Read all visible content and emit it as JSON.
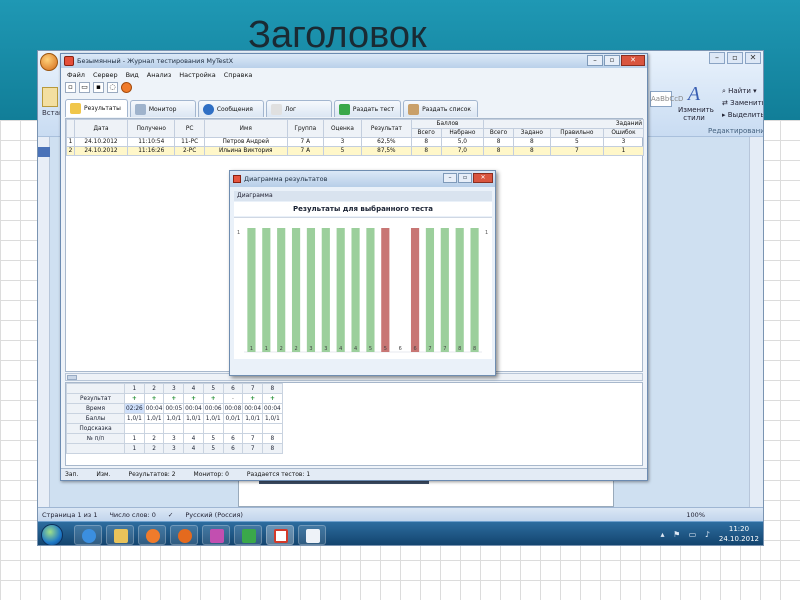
{
  "slide": {
    "title": "Заголовок"
  },
  "colors": {
    "band": "#1d93b0",
    "correct": "#9ccf9c",
    "wrong": "#c87674"
  },
  "word": {
    "left_label": "Вставит",
    "change_styles": "Изменить стили",
    "find": "Найти",
    "replace": "Заменить",
    "select": "Выделить",
    "edit_group": "Редактирование",
    "style_pill": "AaBbCcD"
  },
  "window": {
    "title": "Безымянный - Журнал тестирования MyTestX",
    "menu": [
      "Файл",
      "Сервер",
      "Вид",
      "Анализ",
      "Настройка",
      "Справка"
    ],
    "tabs": [
      "Результаты",
      "Монитор",
      "Сообщения",
      "Лог",
      "Раздать тест",
      "Раздать список"
    ]
  },
  "results": {
    "headers": [
      "Дата",
      "Получено",
      "PC",
      "Имя",
      "Группа",
      "Оценка",
      "Результат"
    ],
    "balls_header": "Баллов",
    "tasks_header": "Заданий",
    "sub": [
      "Всего",
      "Набрано",
      "Всего",
      "Задано",
      "Правильно",
      "Ошибок"
    ],
    "rows": [
      {
        "n": "1",
        "date": "24.10.2012",
        "got": "11:10:54",
        "pc": "11-PC",
        "name": "Петров Андрей",
        "group": "7 А",
        "mark": "3",
        "result": "62,5%",
        "b_total": "8",
        "b_got": "5,0",
        "t_total": "8",
        "t_given": "8",
        "t_right": "5",
        "t_err": "3"
      },
      {
        "n": "2",
        "date": "24.10.2012",
        "got": "11:16:26",
        "pc": "2-PC",
        "name": "Ильина Виктория",
        "group": "7 А",
        "mark": "5",
        "result": "87,5%",
        "b_total": "8",
        "b_got": "7,0",
        "t_total": "8",
        "t_given": "8",
        "t_right": "7",
        "t_err": "1"
      }
    ]
  },
  "detail": {
    "cols": [
      "1",
      "2",
      "3",
      "4",
      "5",
      "6",
      "7",
      "8"
    ],
    "result_label": "Результат",
    "result_marks": [
      "+",
      "+",
      "+",
      "+",
      "+",
      "-",
      "+",
      "+"
    ],
    "time_label": "Время",
    "times": [
      "02:26",
      "00:04",
      "00:05",
      "00:04",
      "00:06",
      "00:08",
      "00:04",
      "00:04"
    ],
    "balls_label": "Баллы",
    "balls": [
      "1,0/1",
      "1,0/1",
      "1,0/1",
      "1,0/1",
      "1,0/1",
      "0,0/1",
      "1,0/1",
      "1,0/1"
    ],
    "hint_label": "Подсказка",
    "num_label": "№ п/п",
    "nums": [
      "1",
      "2",
      "3",
      "4",
      "5",
      "6",
      "7",
      "8"
    ],
    "footer": [
      "1",
      "2",
      "3",
      "4",
      "5",
      "6",
      "7",
      "8"
    ]
  },
  "status": {
    "zap": "Зап.",
    "izm": "Изм.",
    "results": "Результатов: 2",
    "monitor": "Монитор: 0",
    "given": "Раздается тестов: 1"
  },
  "dialog": {
    "title": "Диаграмма результатов",
    "subtitle": "Диаграмма",
    "heading": "Результаты для выбранного теста"
  },
  "chart_data": {
    "type": "bar",
    "title": "Результаты для выбранного теста",
    "ylim": [
      0,
      1
    ],
    "y_ticks": [
      "1",
      "1"
    ],
    "categories": [
      "1",
      "2",
      "3",
      "4",
      "5",
      "6",
      "7",
      "8"
    ],
    "series": [
      {
        "values": [
          1,
          1,
          1,
          1,
          1,
          0,
          1,
          1
        ],
        "labels": [
          "1",
          "2",
          "3",
          "4",
          "5",
          "6",
          "7",
          "8"
        ],
        "status": [
          "correct",
          "correct",
          "correct",
          "correct",
          "correct",
          "wrong",
          "correct",
          "correct"
        ]
      },
      {
        "values": [
          1,
          1,
          1,
          1,
          1,
          1,
          1,
          1
        ],
        "labels": [
          "1",
          "2",
          "3",
          "4",
          "5",
          "6",
          "7",
          "8"
        ],
        "status": [
          "correct",
          "correct",
          "correct",
          "correct",
          "wrong",
          "wrong",
          "correct",
          "correct"
        ]
      }
    ]
  },
  "word_status": {
    "page": "Страница 1 из 1",
    "words": "Число слов: 0",
    "lang": "Русский (Россия)",
    "zoom": "100%"
  },
  "taskbar": {
    "time": "11:20",
    "date": "24.10.2012"
  }
}
